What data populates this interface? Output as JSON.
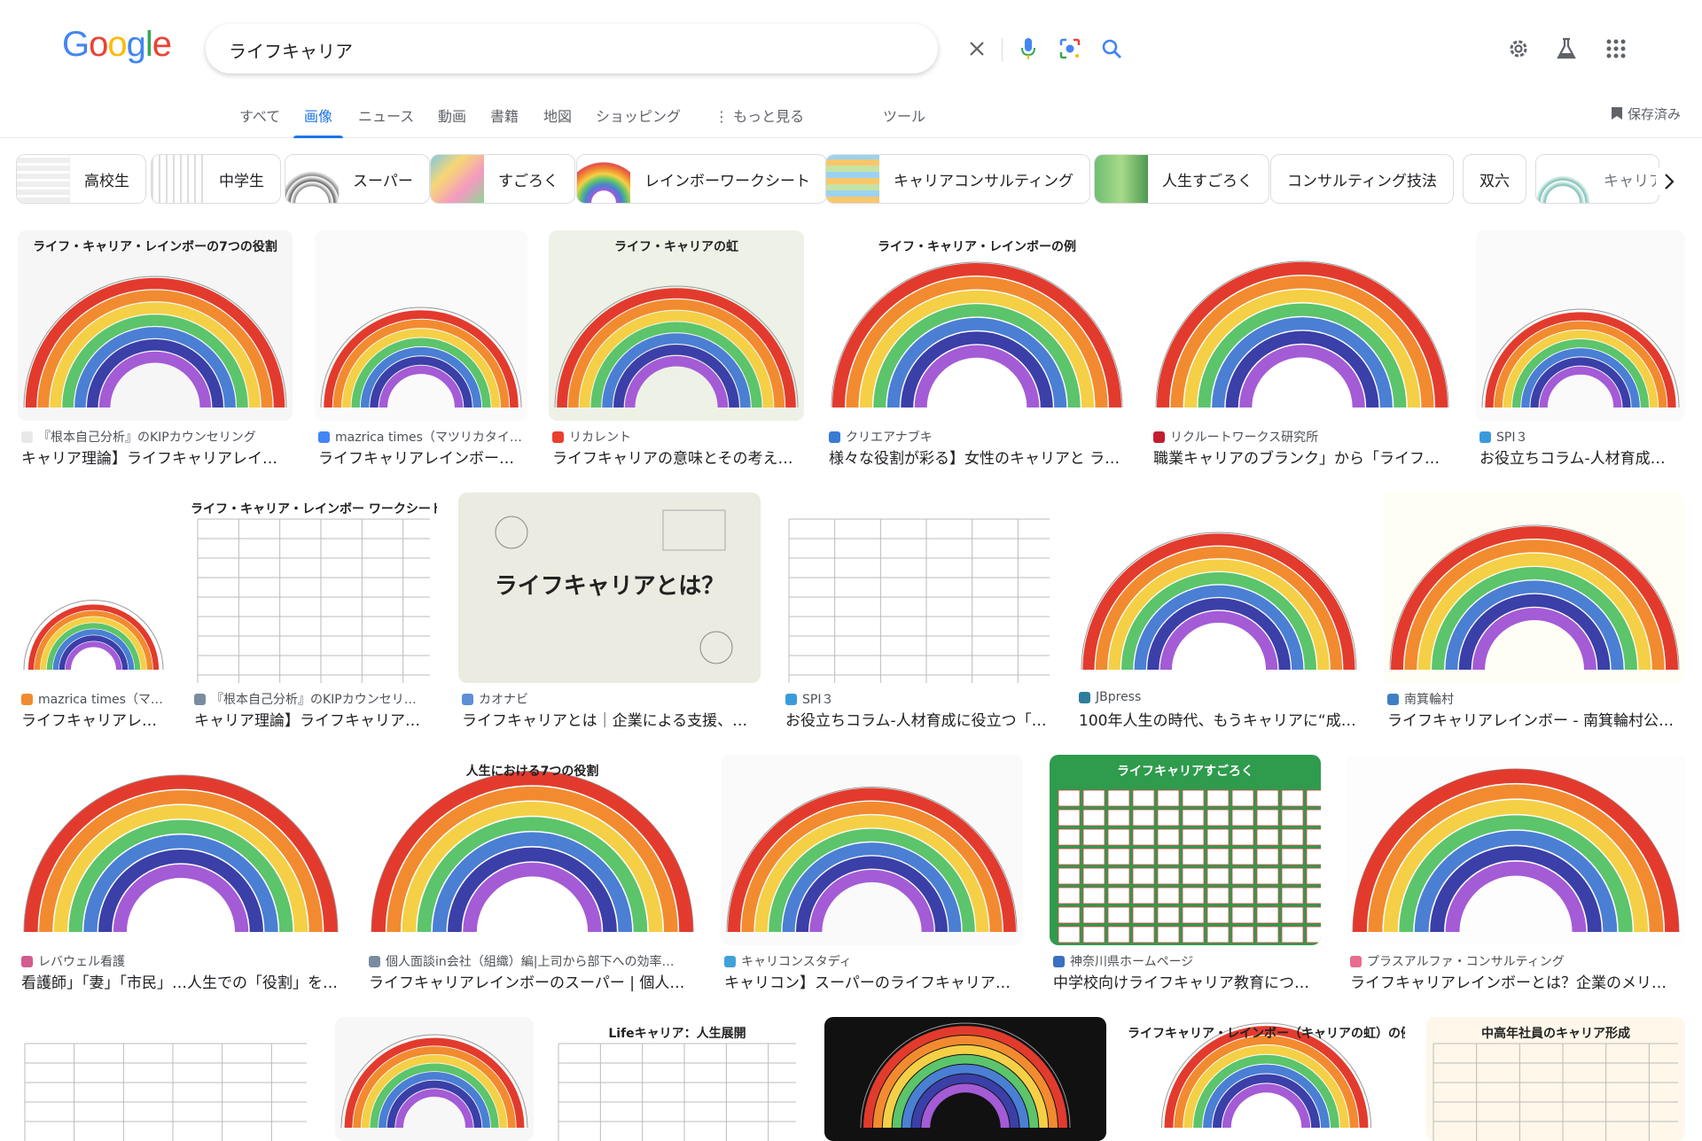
{
  "logo": "Google",
  "search": {
    "query": "ライフキャリア"
  },
  "tabs": [
    "すべて",
    "画像",
    "ニュース",
    "動画",
    "書籍",
    "地図",
    "ショッピング",
    "もっと見る",
    "ツール"
  ],
  "saved_label": "保存済み",
  "chips": [
    "高校生",
    "中学生",
    "スーパー",
    "すごろく",
    "レインボーワークシート",
    "キャリアコンサルティング",
    "人生すごろく",
    "コンサルティング技法",
    "双六",
    "キャリア"
  ],
  "results": [
    {
      "source": "『根本自己分析』のKIPカウンセリング",
      "title": "キャリア理論】ライフキャリアレイ…",
      "img_title": "ライフ・キャリア・レインボーの7つの役割"
    },
    {
      "source": "mazrica times（マツリカタイ…",
      "title": "ライフキャリアレインボー…"
    },
    {
      "source": "リカレント",
      "title": "ライフキャリアの意味とその考え…",
      "img_title": "ライフ・キャリアの虹"
    },
    {
      "source": "クリエアナブキ",
      "title": "様々な役割が彩る】女性のキャリアと ラ…",
      "img_title": "ライフ・キャリア・レインボーの例"
    },
    {
      "source": "リクルートワークス研究所",
      "title": "職業キャリアのブランク」から「ライフ…"
    },
    {
      "source": "SPI３",
      "title": "お役立ちコラム-人材育成…"
    },
    {
      "source": "mazrica times（マ…",
      "title": "ライフキャリアレ…"
    },
    {
      "source": "『根本自己分析』のKIPカウンセリ…",
      "title": "キャリア理論】ライフキャリア…",
      "img_title": "ライフ・キャリア・レインボー ワークシート"
    },
    {
      "source": "カオナビ",
      "title": "ライフキャリアとは｜企業による支援、…",
      "img_title": "ライフキャリアとは？"
    },
    {
      "source": "SPI３",
      "title": "お役立ちコラム-人材育成に役立つ「…"
    },
    {
      "source": "JBpress",
      "title": "100年人生の時代、もうキャリアに“成…"
    },
    {
      "source": "南箕輪村",
      "title": "ライフキャリアレインボー - 南箕輪村公…"
    },
    {
      "source": "レバウェル看護",
      "title": "看護師」「妻」「市民」…人生での「役割」を…"
    },
    {
      "source": "個人面談in会社（組織）編|上司から部下への効率…",
      "title": "ライフキャリアレインボーのスーパー | 個人面…",
      "img_title": "人生における7つの役割"
    },
    {
      "source": "キャリコンスタディ",
      "title": "キャリコン】スーパーのライフキャリア…"
    },
    {
      "source": "神奈川県ホームページ",
      "title": "中学校向けライフキャリア教育につい…",
      "img_title": "ライフキャリアすごろく"
    },
    {
      "source": "プラスアルファ・コンサルティング",
      "title": "ライフキャリアレインボーとは？企業のメリ…"
    },
    {
      "img_title": ""
    },
    {
      "img_title": ""
    },
    {
      "img_title": "Lifeキャリア：人生展開"
    },
    {
      "img_title": ""
    },
    {
      "img_title": "ライフキャリア・レインボー（キャリアの虹）の例"
    },
    {
      "img_title": "中高年社員のキャリア形成"
    }
  ],
  "colors": {
    "accent": "#1a73e8",
    "text": "#202124",
    "muted": "#5f6368"
  }
}
